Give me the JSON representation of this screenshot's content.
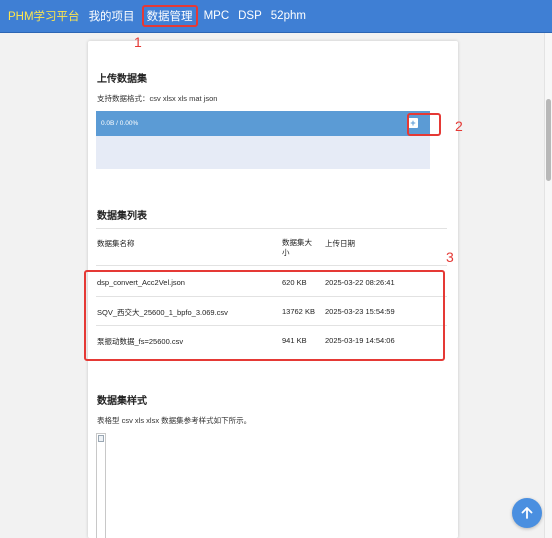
{
  "nav": {
    "brand": "PHM学习平台",
    "items": [
      "我的项目",
      "数据管理",
      "MPC",
      "DSP",
      "52phm"
    ]
  },
  "upload": {
    "title": "上传数据集",
    "formats": "支持数据格式：csv xlsx xls mat json",
    "progress": "0.0B / 0.00%",
    "button_icon": "add-icon"
  },
  "dataset_list": {
    "title": "数据集列表",
    "headers": [
      "数据集名称",
      "数据集大小",
      "上传日期"
    ],
    "rows": [
      {
        "name": "dsp_convert_Acc2Vel.json",
        "size": "620 KB",
        "date": "2025-03-22 08:26:41"
      },
      {
        "name": "SQV_西交大_25600_1_bpfo_3.069.csv",
        "size": "13762 KB",
        "date": "2025-03-23 15:54:59"
      },
      {
        "name": "泵振动数据_fs=25600.csv",
        "size": "941 KB",
        "date": "2025-03-19 14:54:06"
      }
    ]
  },
  "sample": {
    "title": "数据集样式",
    "desc": "表格型 csv xls xlsx 数据集参考样式如下所示。"
  },
  "annotations": [
    "1",
    "2",
    "3"
  ],
  "colors": {
    "navbar": "#3f7fd4",
    "brand": "#ffe64d",
    "highlight": "#e53935",
    "upload_bar": "#5b9bd5",
    "drop_area": "#e6ebf6"
  }
}
